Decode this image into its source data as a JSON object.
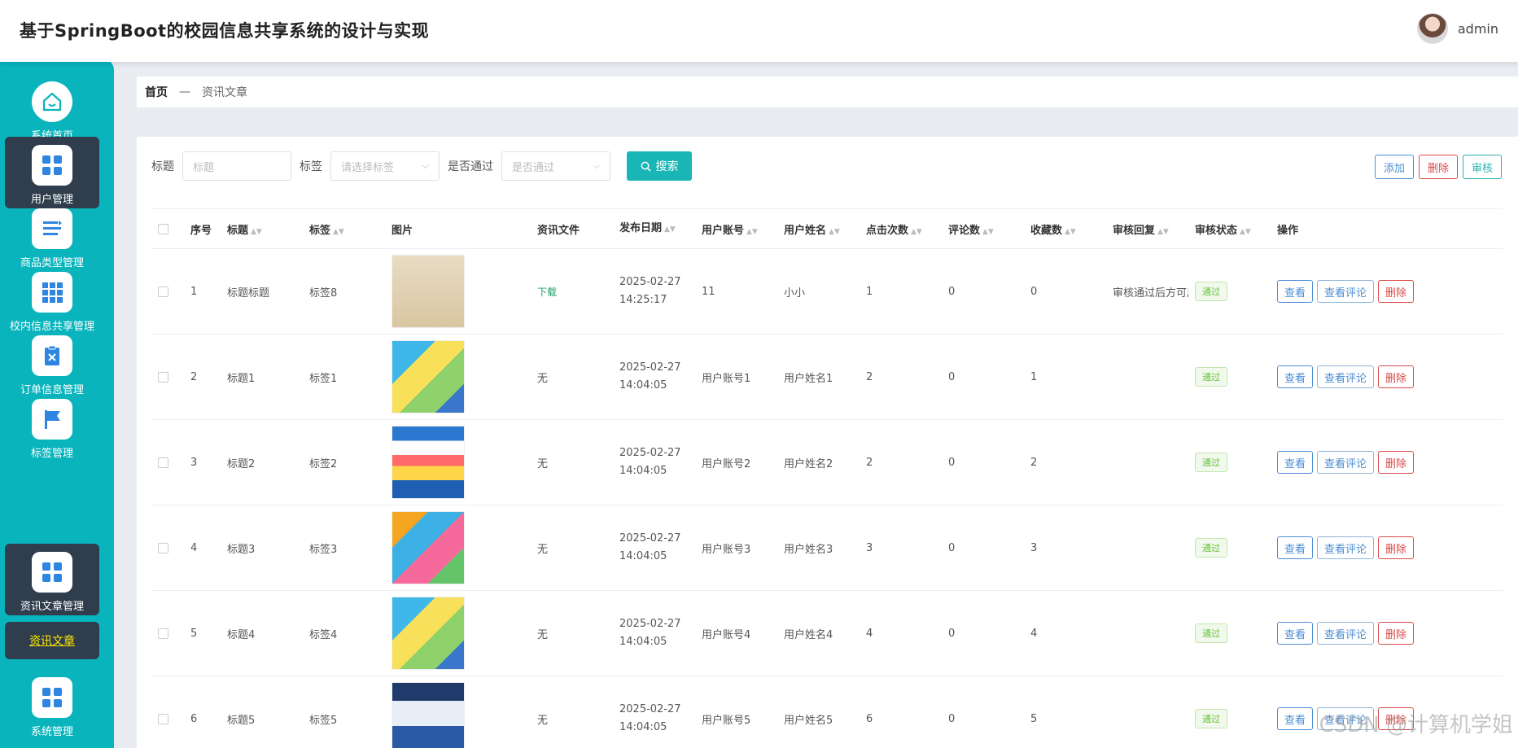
{
  "header": {
    "title": "基于SpringBoot的校园信息共享系统的设计与实现",
    "username": "admin"
  },
  "sidebar": {
    "items": [
      {
        "label": "系统首页",
        "icon": "home-icon"
      },
      {
        "label": "用户管理",
        "icon": "grid-icon"
      },
      {
        "label": "商品类型管理",
        "icon": "list-icon"
      },
      {
        "label": "校内信息共享管理",
        "icon": "grid9-icon"
      },
      {
        "label": "订单信息管理",
        "icon": "clipboard-icon"
      },
      {
        "label": "标签管理",
        "icon": "flag-icon"
      },
      {
        "label": "资讯文章管理",
        "icon": "grid-icon"
      },
      {
        "label": "系统管理",
        "icon": "grid-icon"
      }
    ],
    "submenu": "资讯文章"
  },
  "breadcrumb": {
    "home": "首页",
    "sep": "—",
    "current": "资讯文章"
  },
  "search": {
    "title_label": "标题",
    "title_placeholder": "标题",
    "tag_label": "标签",
    "tag_placeholder": "请选择标签",
    "pass_label": "是否通过",
    "pass_placeholder": "是否通过",
    "search_button": "搜索"
  },
  "actions": {
    "add": "添加",
    "delete": "删除",
    "audit": "审核"
  },
  "table": {
    "headers": [
      "序号",
      "标题",
      "标签",
      "图片",
      "资讯文件",
      "发布日期",
      "用户账号",
      "用户姓名",
      "点击次数",
      "评论数",
      "收藏数",
      "审核回复",
      "审核状态",
      "操作"
    ],
    "rows": [
      {
        "no": "1",
        "title": "标题标题",
        "tag": "标签8",
        "file": "下载",
        "date": "2025-02-27 14:25:17",
        "account": "11",
        "name": "小小",
        "clicks": "1",
        "comments": "0",
        "favs": "0",
        "reply": "审核通过后方可展",
        "status": "通过"
      },
      {
        "no": "2",
        "title": "标题1",
        "tag": "标签1",
        "file": "无",
        "date": "2025-02-27 14:04:05",
        "account": "用户账号1",
        "name": "用户姓名1",
        "clicks": "2",
        "comments": "0",
        "favs": "1",
        "reply": "",
        "status": "通过"
      },
      {
        "no": "3",
        "title": "标题2",
        "tag": "标签2",
        "file": "无",
        "date": "2025-02-27 14:04:05",
        "account": "用户账号2",
        "name": "用户姓名2",
        "clicks": "2",
        "comments": "0",
        "favs": "2",
        "reply": "",
        "status": "通过"
      },
      {
        "no": "4",
        "title": "标题3",
        "tag": "标签3",
        "file": "无",
        "date": "2025-02-27 14:04:05",
        "account": "用户账号3",
        "name": "用户姓名3",
        "clicks": "3",
        "comments": "0",
        "favs": "3",
        "reply": "",
        "status": "通过"
      },
      {
        "no": "5",
        "title": "标题4",
        "tag": "标签4",
        "file": "无",
        "date": "2025-02-27 14:04:05",
        "account": "用户账号4",
        "name": "用户姓名4",
        "clicks": "4",
        "comments": "0",
        "favs": "4",
        "reply": "",
        "status": "通过"
      },
      {
        "no": "6",
        "title": "标题5",
        "tag": "标签5",
        "file": "无",
        "date": "2025-02-27 14:04:05",
        "account": "用户账号5",
        "name": "用户姓名5",
        "clicks": "6",
        "comments": "0",
        "favs": "5",
        "reply": "",
        "status": "通过"
      }
    ],
    "ops": {
      "view": "查看",
      "view_comments": "查看评论",
      "delete": "删除"
    }
  },
  "watermark": "CSDN @计算机学姐"
}
